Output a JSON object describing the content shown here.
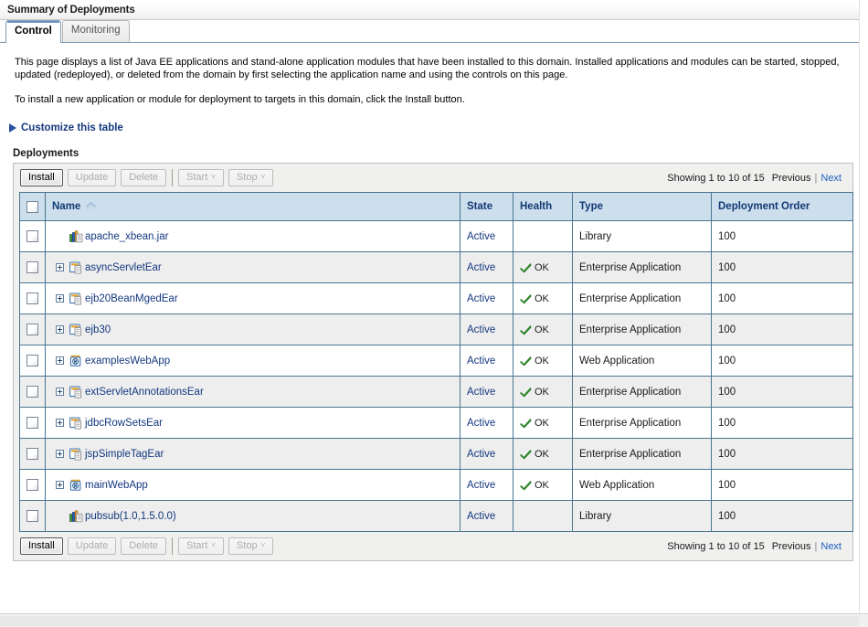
{
  "window": {
    "title": "Summary of Deployments"
  },
  "tabs": [
    {
      "label": "Control",
      "active": true
    },
    {
      "label": "Monitoring",
      "active": false
    }
  ],
  "description": {
    "paragraph1": "This page displays a list of Java EE applications and stand-alone application modules that have been installed to this domain. Installed applications and modules can be started, stopped, updated (redeployed), or deleted from the domain by first selecting the application name and using the controls on this page.",
    "paragraph2": "To install a new application or module for deployment to targets in this domain, click the Install button."
  },
  "customize": {
    "label": "Customize this table",
    "icon": "triangle-right-icon",
    "expanded": false
  },
  "section": {
    "title": "Deployments"
  },
  "toolbar": {
    "buttons": [
      {
        "label": "Install",
        "enabled": true,
        "has_caret": false
      },
      {
        "label": "Update",
        "enabled": false,
        "has_caret": false
      },
      {
        "label": "Delete",
        "enabled": false,
        "has_caret": false
      },
      {
        "label": "Start",
        "enabled": false,
        "has_caret": true
      },
      {
        "label": "Stop",
        "enabled": false,
        "has_caret": true
      }
    ],
    "caret_glyph": "˅"
  },
  "pagination": {
    "showing": "Showing 1 to 10 of 15",
    "previous": "Previous",
    "separator": "|",
    "next": "Next"
  },
  "table": {
    "columns": [
      {
        "key": "check",
        "label": "",
        "sorted": false
      },
      {
        "key": "name",
        "label": "Name",
        "sorted": true,
        "sort_direction": "asc",
        "sort_icon": "sort-ascending-icon"
      },
      {
        "key": "state",
        "label": "State",
        "sorted": false
      },
      {
        "key": "health",
        "label": "Health",
        "sorted": false
      },
      {
        "key": "type",
        "label": "Type",
        "sorted": false
      },
      {
        "key": "order",
        "label": "Deployment Order",
        "sorted": false
      }
    ],
    "health_ok_label": "OK",
    "rows": [
      {
        "name": "apache_xbean.jar",
        "icon": "library-icon",
        "expandable": false,
        "state": "Active",
        "health": "",
        "type": "Library",
        "order": "100"
      },
      {
        "name": "asyncServletEar",
        "icon": "ear-icon",
        "expandable": true,
        "state": "Active",
        "health": "OK",
        "type": "Enterprise Application",
        "order": "100"
      },
      {
        "name": "ejb20BeanMgedEar",
        "icon": "ear-icon",
        "expandable": true,
        "state": "Active",
        "health": "OK",
        "type": "Enterprise Application",
        "order": "100"
      },
      {
        "name": "ejb30",
        "icon": "ear-icon",
        "expandable": true,
        "state": "Active",
        "health": "OK",
        "type": "Enterprise Application",
        "order": "100"
      },
      {
        "name": "examplesWebApp",
        "icon": "webapp-icon",
        "expandable": true,
        "state": "Active",
        "health": "OK",
        "type": "Web Application",
        "order": "100"
      },
      {
        "name": "extServletAnnotationsEar",
        "icon": "ear-icon",
        "expandable": true,
        "state": "Active",
        "health": "OK",
        "type": "Enterprise Application",
        "order": "100"
      },
      {
        "name": "jdbcRowSetsEar",
        "icon": "ear-icon",
        "expandable": true,
        "state": "Active",
        "health": "OK",
        "type": "Enterprise Application",
        "order": "100"
      },
      {
        "name": "jspSimpleTagEar",
        "icon": "ear-icon",
        "expandable": true,
        "state": "Active",
        "health": "OK",
        "type": "Enterprise Application",
        "order": "100"
      },
      {
        "name": "mainWebApp",
        "icon": "webapp-icon",
        "expandable": true,
        "state": "Active",
        "health": "OK",
        "type": "Web Application",
        "order": "100"
      },
      {
        "name": "pubsub(1.0,1.5.0.0)",
        "icon": "library-icon",
        "expandable": false,
        "state": "Active",
        "health": "",
        "type": "Library",
        "order": "100"
      }
    ]
  },
  "colors": {
    "header_background": "#cddeec",
    "header_text": "#123a75",
    "link": "#14387f",
    "grid_border": "#4a7590",
    "row_alt": "#eeeeee",
    "health_ok": "#2f9a28",
    "next_link": "#1b5fbe"
  }
}
